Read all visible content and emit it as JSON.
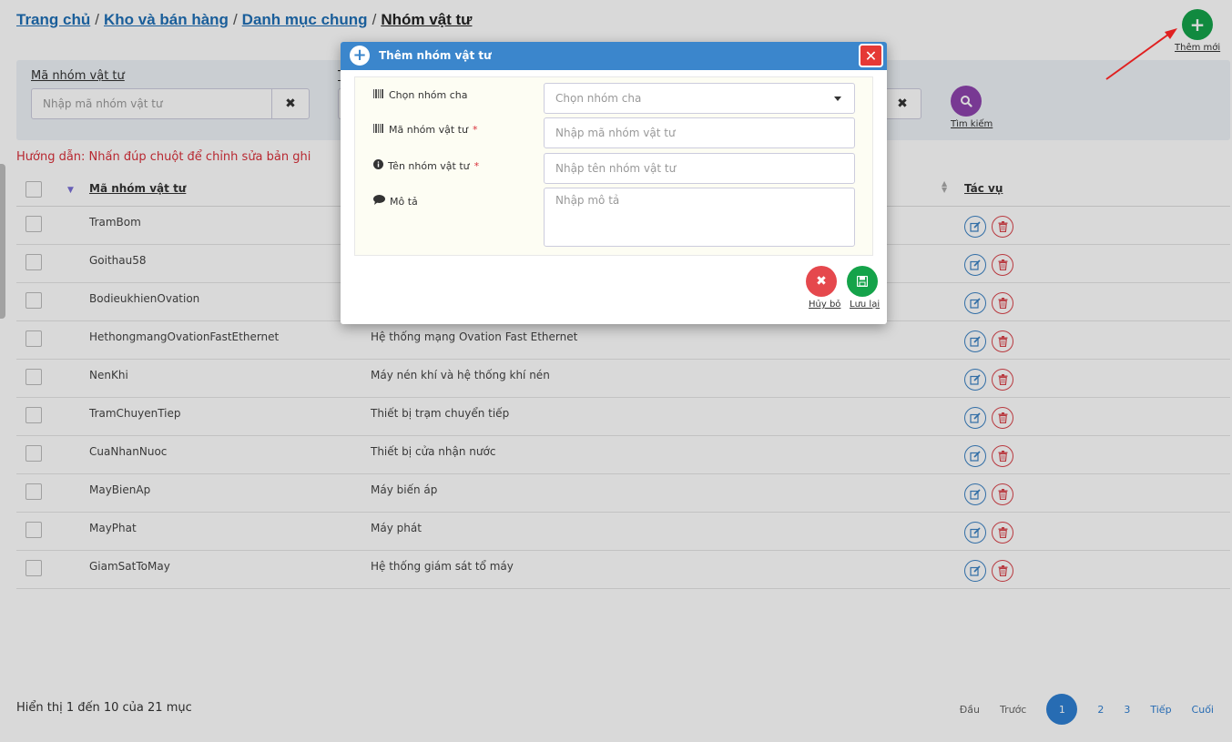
{
  "breadcrumb": {
    "home": "Trang chủ",
    "level2": "Kho và bán hàng",
    "level3": "Danh mục chung",
    "current": "Nhóm vật tư",
    "separator": "/"
  },
  "toolbar": {
    "add_label": "Thêm mới",
    "add_symbol": "+"
  },
  "search": {
    "code_label": "Mã nhóm vật tư",
    "code_placeholder": "Nhập mã nhóm vật tư",
    "second_label_fragment": "T",
    "clear_symbol": "✖",
    "search_label": "Tìm kiếm"
  },
  "hint": "Hướng dẫn: Nhấn đúp chuột để chỉnh sửa bản ghi",
  "table": {
    "col_code": "Mã nhóm vật tư",
    "col_action": "Tác vụ",
    "rows": [
      {
        "code": "TramBom",
        "name": ""
      },
      {
        "code": "Goithau58",
        "name": ""
      },
      {
        "code": "BodieukhienOvation",
        "name": ""
      },
      {
        "code": "HethongmangOvationFastEthernet",
        "name": "Hệ thống mạng Ovation Fast Ethernet"
      },
      {
        "code": "NenKhi",
        "name": "Máy nén khí và hệ thống khí nén"
      },
      {
        "code": "TramChuyenTiep",
        "name": "Thiết bị trạm chuyển tiếp"
      },
      {
        "code": "CuaNhanNuoc",
        "name": "Thiết bị cửa nhận nước"
      },
      {
        "code": "MayBienAp",
        "name": "Máy biến áp"
      },
      {
        "code": "MayPhat",
        "name": "Máy phát"
      },
      {
        "code": "GiamSatToMay",
        "name": "Hệ thống giám sát tổ máy"
      }
    ]
  },
  "footer": {
    "info": "Hiển thị 1 đến 10 của 21 mục",
    "first": "Đầu",
    "prev": "Trước",
    "pages": [
      "1",
      "2",
      "3"
    ],
    "next": "Tiếp",
    "last": "Cuối"
  },
  "modal": {
    "title": "Thêm nhóm vật tư",
    "close_symbol": "✕",
    "parent_label": "Chọn nhóm cha",
    "parent_placeholder": "Chọn nhóm cha",
    "code_label": "Mã nhóm vật tư",
    "code_placeholder": "Nhập mã nhóm vật tư",
    "name_label": "Tên nhóm vật tư",
    "name_placeholder": "Nhập tên nhóm vật tư",
    "desc_label": "Mô tả",
    "desc_placeholder": "Nhập mô tả",
    "required_mark": "*",
    "cancel_label": "Hủy bỏ",
    "save_label": "Lưu lại"
  },
  "colors": {
    "primary": "#3b86cc",
    "add_green": "#15a34a",
    "danger": "#e5484d",
    "search_purple": "#8e44ad",
    "hint_red": "#d9303a"
  }
}
